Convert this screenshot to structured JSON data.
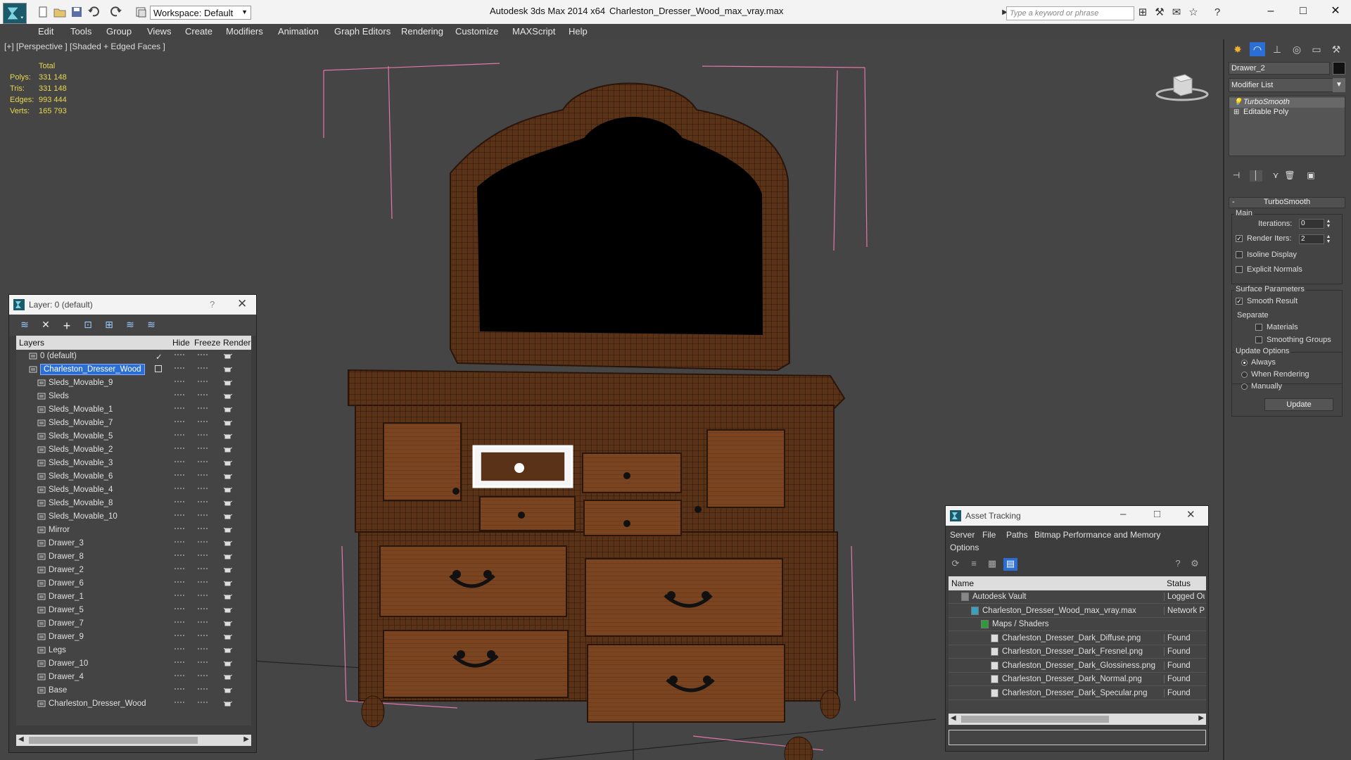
{
  "title_bar": {
    "app_title": "Autodesk 3ds Max  2014 x64",
    "file_title": "Charleston_Dresser_Wood_max_vray.max",
    "workspace_label": "Workspace: Default",
    "search_placeholder": "Type a keyword or phrase"
  },
  "menu": [
    "Edit",
    "Tools",
    "Group",
    "Views",
    "Create",
    "Modifiers",
    "Animation",
    "Graph Editors",
    "Rendering",
    "Customize",
    "MAXScript",
    "Help"
  ],
  "viewport": {
    "label": "[+] [Perspective ] [Shaded + Edged Faces ]",
    "stats": {
      "header": "Total",
      "rows": [
        {
          "label": "Polys:",
          "value": "331 148"
        },
        {
          "label": "Tris:",
          "value": "331 148"
        },
        {
          "label": "Edges:",
          "value": "993 444"
        },
        {
          "label": "Verts:",
          "value": "165 793"
        }
      ]
    }
  },
  "layer_panel": {
    "title": "Layer: 0 (default)",
    "help": "?",
    "columns": {
      "layers": "Layers",
      "hide": "Hide",
      "freeze": "Freeze",
      "render": "Render"
    },
    "layers": [
      "0 (default)",
      "Charleston_Dresser_Wood",
      "Sleds_Movable_9",
      "Sleds",
      "Sleds_Movable_1",
      "Sleds_Movable_7",
      "Sleds_Movable_5",
      "Sleds_Movable_2",
      "Sleds_Movable_3",
      "Sleds_Movable_6",
      "Sleds_Movable_4",
      "Sleds_Movable_8",
      "Sleds_Movable_10",
      "Mirror",
      "Drawer_3",
      "Drawer_8",
      "Drawer_2",
      "Drawer_6",
      "Drawer_1",
      "Drawer_5",
      "Drawer_7",
      "Drawer_9",
      "Legs",
      "Drawer_10",
      "Drawer_4",
      "Base",
      "Charleston_Dresser_Wood"
    ]
  },
  "asset_panel": {
    "title": "Asset Tracking",
    "menu": [
      "Server",
      "File",
      "Paths",
      "Bitmap Performance and Memory",
      "Options"
    ],
    "columns": {
      "name": "Name",
      "status": "Status"
    },
    "rows": [
      {
        "name": "Autodesk Vault",
        "status": "Logged Ou"
      },
      {
        "name": "Charleston_Dresser_Wood_max_vray.max",
        "status": "Network P"
      },
      {
        "name": "Maps / Shaders",
        "status": ""
      },
      {
        "name": "Charleston_Dresser_Dark_Diffuse.png",
        "status": "Found"
      },
      {
        "name": "Charleston_Dresser_Dark_Fresnel.png",
        "status": "Found"
      },
      {
        "name": "Charleston_Dresser_Dark_Glossiness.png",
        "status": "Found"
      },
      {
        "name": "Charleston_Dresser_Dark_Normal.png",
        "status": "Found"
      },
      {
        "name": "Charleston_Dresser_Dark_Specular.png",
        "status": "Found"
      }
    ]
  },
  "command_panel": {
    "object_name": "Drawer_2",
    "modifier_list": "Modifier List",
    "stack": [
      "TurboSmooth",
      "Editable Poly"
    ],
    "rollout_title": "TurboSmooth",
    "main_group": "Main",
    "iterations_label": "Iterations:",
    "iterations_value": "0",
    "render_iters_label": "Render Iters:",
    "render_iters_value": "2",
    "isoline_label": "Isoline Display",
    "explicit_normals_label": "Explicit Normals",
    "surface_group": "Surface Parameters",
    "smooth_result_label": "Smooth Result",
    "separate_label": "Separate",
    "materials_label": "Materials",
    "smoothing_groups_label": "Smoothing Groups",
    "update_group": "Update Options",
    "always_label": "Always",
    "when_rendering_label": "When Rendering",
    "manually_label": "Manually",
    "update_button": "Update"
  }
}
